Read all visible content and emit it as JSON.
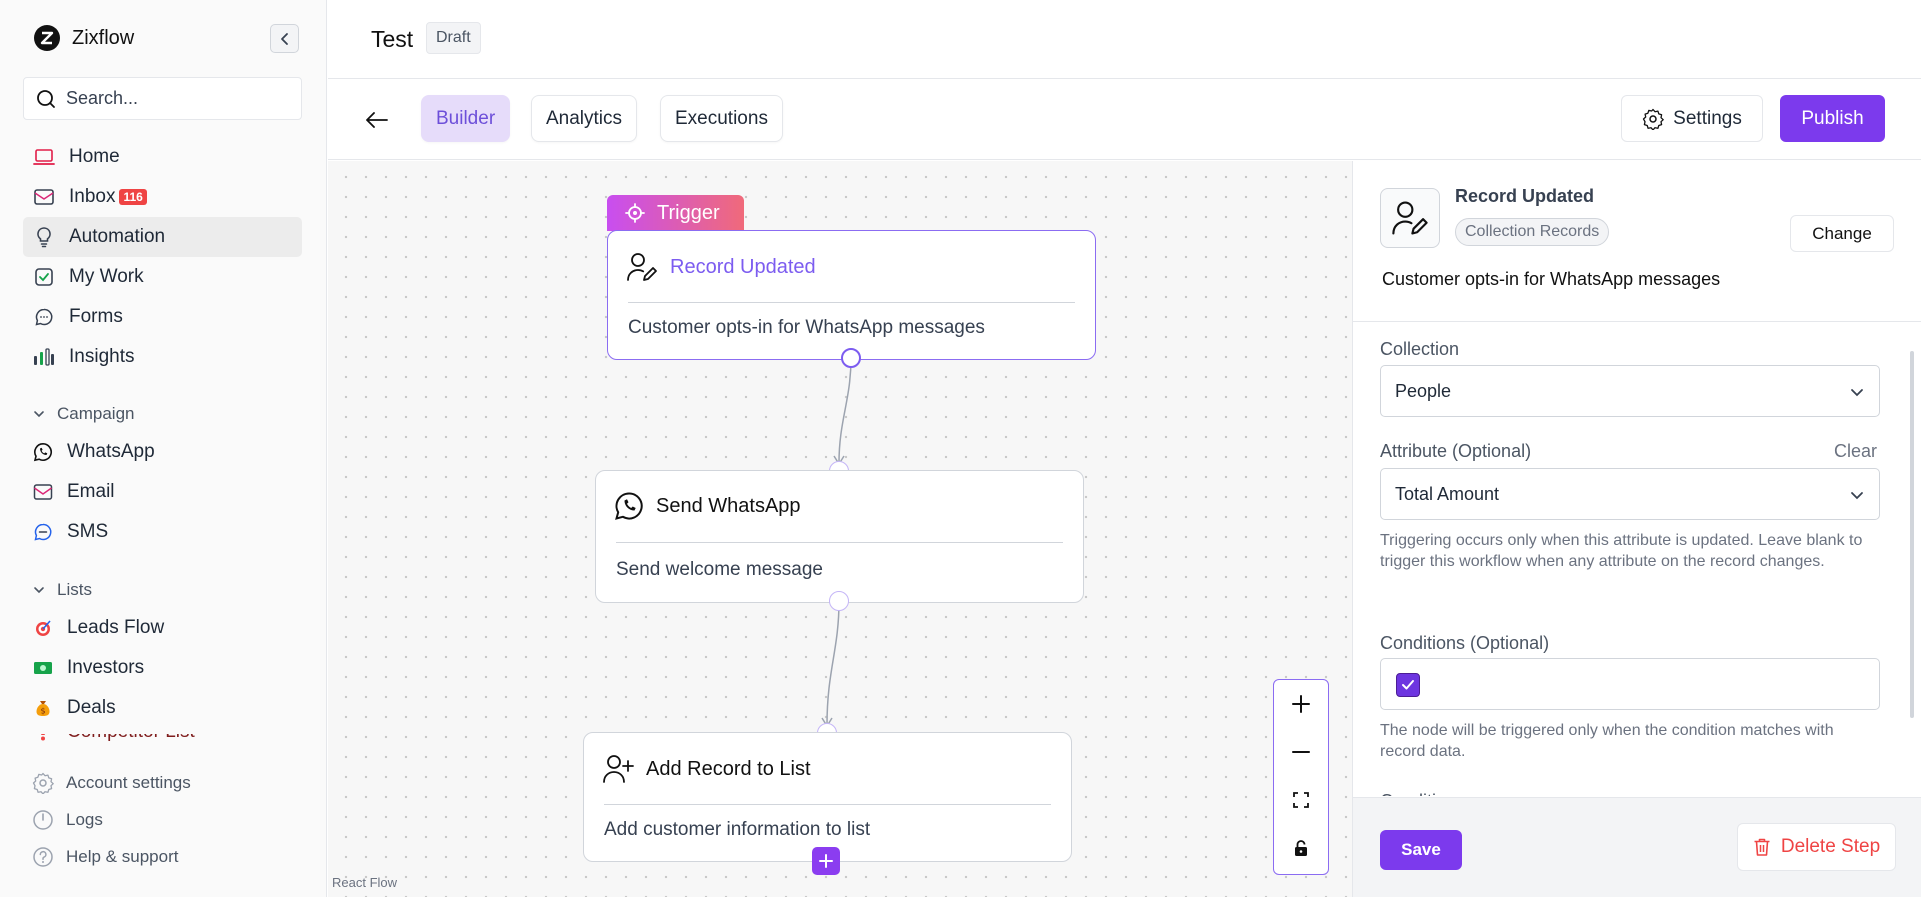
{
  "sidebar": {
    "brand": "Zixflow",
    "search_placeholder": "Search...",
    "nav": [
      {
        "label": "Home",
        "icon": "laptop-icon"
      },
      {
        "label": "Inbox",
        "icon": "mail-icon",
        "badge": "116"
      },
      {
        "label": "Automation",
        "icon": "lightbulb-icon",
        "active": true
      },
      {
        "label": "My Work",
        "icon": "checkbox-icon"
      },
      {
        "label": "Forms",
        "icon": "chat-bubble-icon"
      },
      {
        "label": "Insights",
        "icon": "bar-chart-icon"
      }
    ],
    "campaign_section": "Campaign",
    "campaign_items": [
      {
        "label": "WhatsApp",
        "icon": "whatsapp-icon"
      },
      {
        "label": "Email",
        "icon": "mail-icon"
      },
      {
        "label": "SMS",
        "icon": "sms-bubble-icon"
      }
    ],
    "lists_section": "Lists",
    "list_items": [
      {
        "label": "Leads Flow",
        "icon": "target-emoji-icon"
      },
      {
        "label": "Investors",
        "icon": "money-emoji-icon"
      },
      {
        "label": "Deals",
        "icon": "money-bag-emoji-icon"
      },
      {
        "label": "Competitor List",
        "icon": "exclamation-emoji-icon"
      }
    ],
    "bottom_links": [
      {
        "label": "Account settings",
        "icon": "gear-icon"
      },
      {
        "label": "Logs",
        "icon": "clock-icon"
      },
      {
        "label": "Help & support",
        "icon": "help-circle-icon"
      }
    ]
  },
  "header": {
    "title": "Test",
    "status": "Draft"
  },
  "toolbar": {
    "tabs": [
      "Builder",
      "Analytics",
      "Executions"
    ],
    "active_tab": "Builder",
    "settings_label": "Settings",
    "publish_label": "Publish"
  },
  "canvas": {
    "trigger_label": "Trigger",
    "nodes": [
      {
        "title": "Record Updated",
        "description": "Customer opts-in for WhatsApp messages",
        "icon": "user-edit-icon"
      },
      {
        "title": "Send WhatsApp",
        "description": "Send welcome message",
        "icon": "whatsapp-icon"
      },
      {
        "title": "Add Record to List",
        "description": "Add customer information to list",
        "icon": "user-add-icon"
      }
    ],
    "attribution": "React Flow"
  },
  "panel": {
    "title": "Record Updated",
    "chip": "Collection Records",
    "change_label": "Change",
    "description": "Customer opts-in for WhatsApp messages",
    "collection_label": "Collection",
    "collection_value": "People",
    "attribute_label": "Attribute (Optional)",
    "clear_label": "Clear",
    "attribute_value": "Total Amount",
    "attribute_help": "Triggering occurs only when this attribute is updated. Leave blank to trigger this workflow when any attribute on the record changes.",
    "conditions_label": "Conditions (Optional)",
    "conditions_checked": true,
    "conditions_help": "The node will be triggered only when the condition matches with record data.",
    "cut_label": "Condition",
    "save_label": "Save",
    "delete_label": "Delete Step"
  },
  "colors": {
    "accent": "#7c3aed",
    "active_tab_bg": "#e6dcfa",
    "danger": "#ef4444",
    "badge": "#ef4444"
  }
}
